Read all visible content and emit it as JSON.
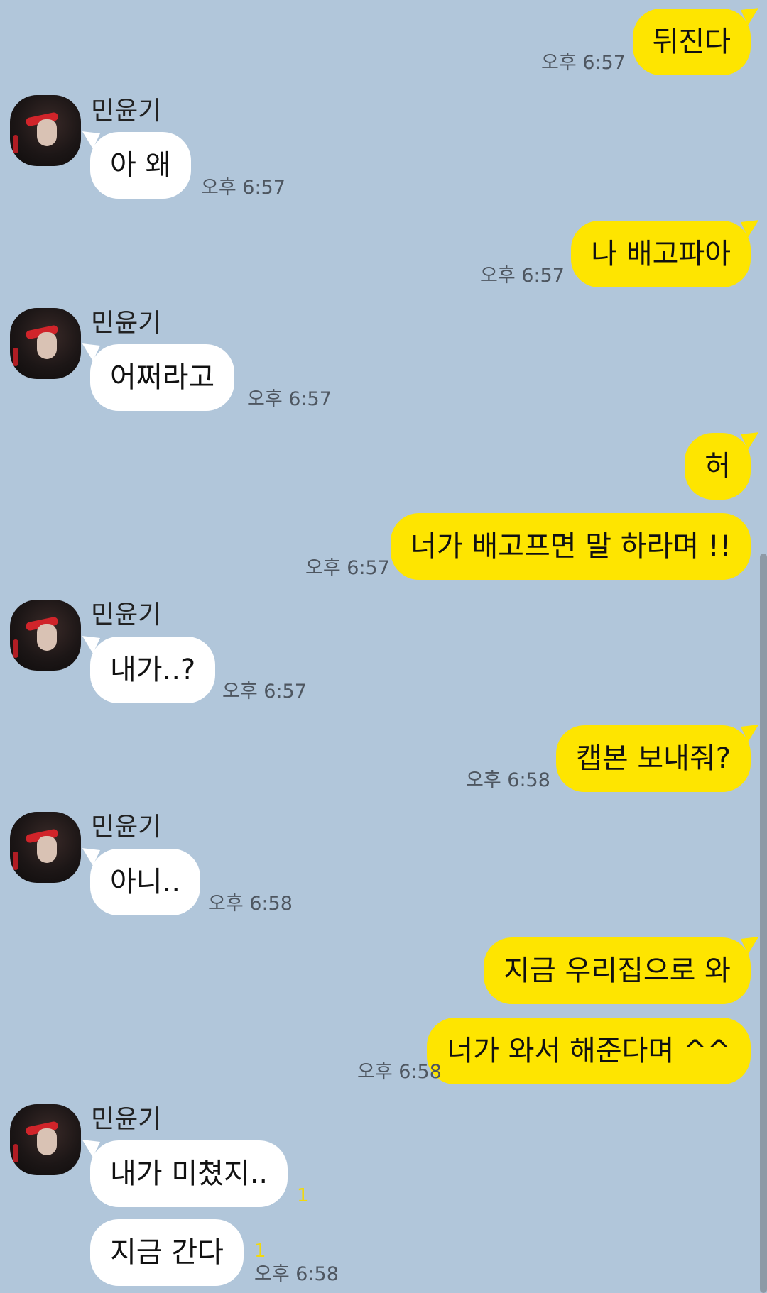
{
  "contact": {
    "name": "민윤기"
  },
  "messages": [
    {
      "text": "뒤진다",
      "time": "오후 6:57"
    },
    {
      "text": "아 왜",
      "time": "오후 6:57"
    },
    {
      "text": "나 배고파아",
      "time": "오후 6:57"
    },
    {
      "text": "어쩌라고",
      "time": "오후 6:57"
    },
    {
      "text": "허",
      "time": ""
    },
    {
      "text": "너가 배고프면 말 하라며 !!",
      "time": "오후 6:57"
    },
    {
      "text": "내가..?",
      "time": "오후 6:57"
    },
    {
      "text": "캡본 보내줘?",
      "time": "오후 6:58"
    },
    {
      "text": "아니..",
      "time": "오후 6:58"
    },
    {
      "text": "지금 우리집으로 와",
      "time": ""
    },
    {
      "text": "너가 와서 해준다며 ^^",
      "time": "오후 6:58"
    },
    {
      "text": "내가 미쳤지..",
      "time": "",
      "unread": "1"
    },
    {
      "text": "지금 간다",
      "time": "오후 6:58",
      "unread": "1"
    }
  ],
  "colors": {
    "background": "#b1c6da",
    "my_bubble": "#fee500",
    "their_bubble": "#ffffff",
    "unread": "#f2d90b"
  }
}
